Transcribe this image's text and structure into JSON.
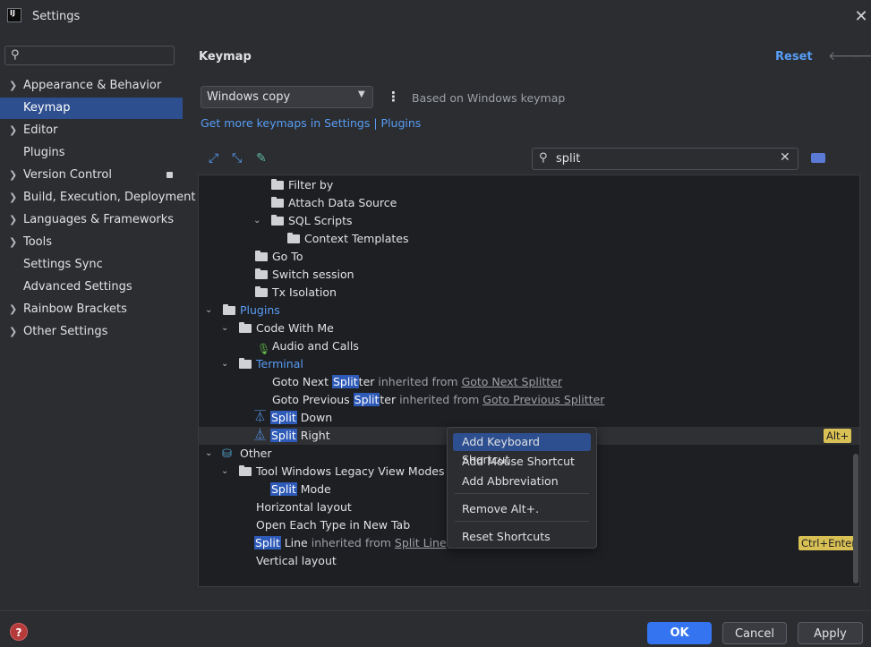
{
  "window": {
    "title": "Settings",
    "logo_text": "IJ"
  },
  "sidebar": {
    "items": [
      {
        "label": "Appearance & Behavior",
        "expandable": true
      },
      {
        "label": "Keymap",
        "expandable": false,
        "active": true
      },
      {
        "label": "Editor",
        "expandable": true
      },
      {
        "label": "Plugins",
        "expandable": false
      },
      {
        "label": "Version Control",
        "expandable": true
      },
      {
        "label": "Build, Execution, Deployment",
        "expandable": true
      },
      {
        "label": "Languages & Frameworks",
        "expandable": true
      },
      {
        "label": "Tools",
        "expandable": true
      },
      {
        "label": "Settings Sync",
        "expandable": false
      },
      {
        "label": "Advanced Settings",
        "expandable": false
      },
      {
        "label": "Rainbow Brackets",
        "expandable": true
      },
      {
        "label": "Other Settings",
        "expandable": true
      }
    ]
  },
  "main": {
    "title": "Keymap",
    "reset_label": "Reset",
    "keymap_select": "Windows copy",
    "based_on": "Based on Windows keymap",
    "get_more": "Get more keymaps in Settings | Plugins",
    "search_value": "split"
  },
  "tree": {
    "filter_by": "Filter by",
    "attach_data_source": "Attach Data Source",
    "sql_scripts": "SQL Scripts",
    "context_templates": "Context Templates",
    "go_to": "Go To",
    "switch_session": "Switch session",
    "tx_isolation": "Tx Isolation",
    "plugins": "Plugins",
    "code_with_me": "Code With Me",
    "audio_and_calls": "Audio and Calls",
    "terminal": "Terminal",
    "goto_next_pre": "Goto Next ",
    "goto_next_hl": "Split",
    "goto_next_post": "ter",
    "goto_next_inh": " inherited from ",
    "goto_next_link": "Goto Next Splitter",
    "goto_prev_pre": "Goto Previous ",
    "goto_prev_hl": "Split",
    "goto_prev_post": "ter",
    "goto_prev_inh": " inherited from ",
    "goto_prev_link": "Goto Previous Splitter",
    "split_down_hl": "Split",
    "split_down_post": " Down",
    "split_right_hl": "Split",
    "split_right_post": " Right",
    "split_right_shortcut": "Alt+",
    "other": "Other",
    "tool_windows": "Tool Windows Legacy View Modes (dep",
    "split_mode_hl": "Split",
    "split_mode_post": " Mode",
    "horizontal_layout": "Horizontal layout",
    "open_each_type": "Open Each Type in New Tab",
    "split_line_hl": "Split",
    "split_line_post": " Line",
    "split_line_inh": " inherited from ",
    "split_line_link": "Split Line",
    "split_line_shortcut": "Ctrl+Enter",
    "vertical_layout": "Vertical layout"
  },
  "context_menu": {
    "add_keyboard_shortcut": "Add Keyboard Shortcut",
    "add_mouse_shortcut": "Add Mouse Shortcut",
    "add_abbreviation": "Add Abbreviation",
    "remove": "Remove Alt+.",
    "reset_shortcuts": "Reset Shortcuts"
  },
  "buttons": {
    "ok": "OK",
    "cancel": "Cancel",
    "apply": "Apply",
    "help": "?"
  },
  "colors": {
    "accent": "#3574f0",
    "link": "#589df6",
    "selection": "#2e4f8f",
    "highlight": "#2e5ab8",
    "shortcut_badge": "#d9c054"
  }
}
